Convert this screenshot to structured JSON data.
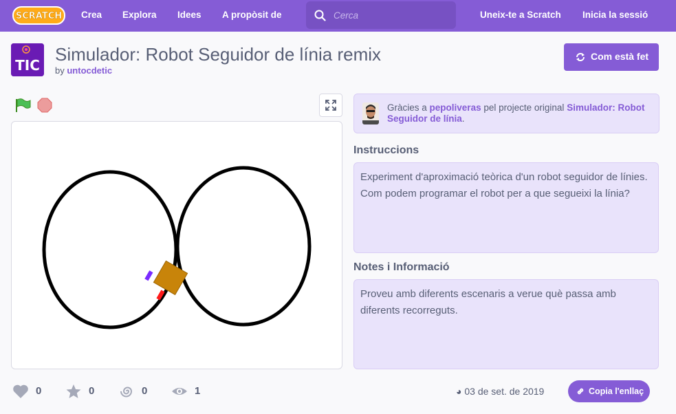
{
  "nav": {
    "logo_text": "SCRATCH",
    "links": [
      "Crea",
      "Explora",
      "Idees",
      "A propòsit de"
    ],
    "search_placeholder": "Cerca",
    "join": "Uneix-te a Scratch",
    "signin": "Inicia la sessió"
  },
  "project": {
    "thumb_text": "TIC",
    "title": "Simulador: Robot Seguidor de línia remix",
    "by_prefix": "by",
    "author": "untocdetic",
    "see_inside": "Com està fet"
  },
  "credits": {
    "prefix": "Gràcies a",
    "user": "pepoliveras",
    "middle": "pel projecte original",
    "project": "Simulador: Robot Seguidor de línia",
    "suffix": "."
  },
  "instructions": {
    "heading": "Instruccions",
    "text": "Experiment d'aproximació teòrica d'un robot seguidor de línies. Com podem programar el robot per a que segueixi la línia?"
  },
  "notes": {
    "heading": "Notes i Informació",
    "text": "Proveu amb diferents escenaris a verue què passa amb diferents recorreguts."
  },
  "stats": {
    "loves": "0",
    "favorites": "0",
    "remixes": "0",
    "views": "1"
  },
  "date": "03 de set. de 2019",
  "copy_link": "Copia l'enllaç",
  "colors": {
    "brand": "#855cd6",
    "panel": "#e9e3fb",
    "text": "#575e75"
  },
  "icons": [
    "search-icon",
    "remix-icon",
    "green-flag-icon",
    "stop-icon",
    "fullscreen-icon",
    "heart-icon",
    "star-icon",
    "remix-spiral-icon",
    "eye-icon",
    "link-icon"
  ]
}
